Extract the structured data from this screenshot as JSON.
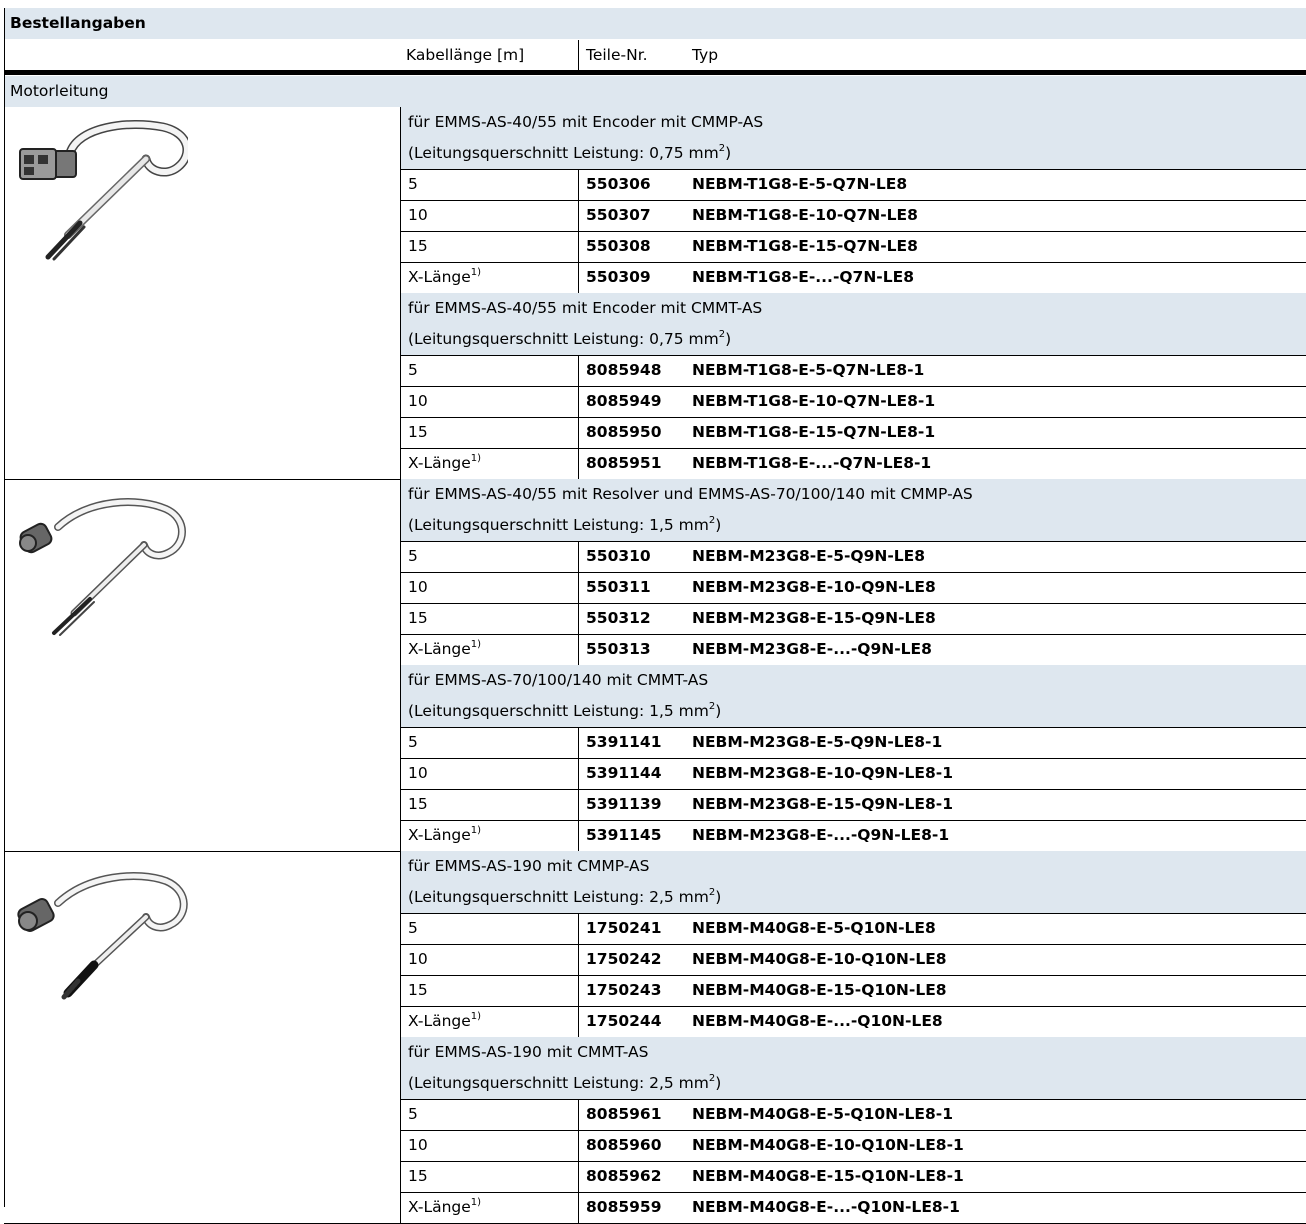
{
  "title": "Bestellangaben",
  "columns": {
    "length": "Kabellänge [m]",
    "part_no": "Teile-Nr.",
    "type": "Typ"
  },
  "section_label": "Motorleitung",
  "groups": [
    {
      "cable": "t1g8",
      "subgroups": [
        {
          "line1": "für EMMS-AS-40/55 mit Encoder mit CMMP-AS",
          "line2_pre": "(Leitungsquerschnitt Leistung: 0,75 mm",
          "line2_sup": "2",
          "line2_post": ")",
          "rows": [
            {
              "length": "5",
              "sup": "",
              "part": "550306",
              "type": "NEBM-T1G8-E-5-Q7N-LE8"
            },
            {
              "length": "10",
              "sup": "",
              "part": "550307",
              "type": "NEBM-T1G8-E-10-Q7N-LE8"
            },
            {
              "length": "15",
              "sup": "",
              "part": "550308",
              "type": "NEBM-T1G8-E-15-Q7N-LE8"
            },
            {
              "length": "X-Länge",
              "sup": "1)",
              "part": "550309",
              "type": "NEBM-T1G8-E-...-Q7N-LE8"
            }
          ]
        },
        {
          "line1": "für EMMS-AS-40/55 mit Encoder mit CMMT-AS",
          "line2_pre": "(Leitungsquerschnitt Leistung: 0,75 mm",
          "line2_sup": "2",
          "line2_post": ")",
          "rows": [
            {
              "length": "5",
              "sup": "",
              "part": "8085948",
              "type": "NEBM-T1G8-E-5-Q7N-LE8-1"
            },
            {
              "length": "10",
              "sup": "",
              "part": "8085949",
              "type": "NEBM-T1G8-E-10-Q7N-LE8-1"
            },
            {
              "length": "15",
              "sup": "",
              "part": "8085950",
              "type": "NEBM-T1G8-E-15-Q7N-LE8-1"
            },
            {
              "length": "X-Länge",
              "sup": "1)",
              "part": "8085951",
              "type": "NEBM-T1G8-E-...-Q7N-LE8-1"
            }
          ]
        }
      ]
    },
    {
      "cable": "m23",
      "subgroups": [
        {
          "line1": "für EMMS-AS-40/55 mit Resolver und EMMS-AS-70/100/140 mit CMMP-AS",
          "line2_pre": "(Leitungsquerschnitt Leistung: 1,5 mm",
          "line2_sup": "2",
          "line2_post": ")",
          "rows": [
            {
              "length": "5",
              "sup": "",
              "part": "550310",
              "type": "NEBM-M23G8-E-5-Q9N-LE8"
            },
            {
              "length": "10",
              "sup": "",
              "part": "550311",
              "type": "NEBM-M23G8-E-10-Q9N-LE8"
            },
            {
              "length": "15",
              "sup": "",
              "part": "550312",
              "type": "NEBM-M23G8-E-15-Q9N-LE8"
            },
            {
              "length": "X-Länge",
              "sup": "1)",
              "part": "550313",
              "type": "NEBM-M23G8-E-...-Q9N-LE8"
            }
          ]
        },
        {
          "line1": "für EMMS-AS-70/100/140 mit CMMT-AS",
          "line2_pre": "(Leitungsquerschnitt Leistung: 1,5 mm",
          "line2_sup": "2",
          "line2_post": ")",
          "rows": [
            {
              "length": "5",
              "sup": "",
              "part": "5391141",
              "type": "NEBM-M23G8-E-5-Q9N-LE8-1"
            },
            {
              "length": "10",
              "sup": "",
              "part": "5391144",
              "type": "NEBM-M23G8-E-10-Q9N-LE8-1"
            },
            {
              "length": "15",
              "sup": "",
              "part": "5391139",
              "type": "NEBM-M23G8-E-15-Q9N-LE8-1"
            },
            {
              "length": "X-Länge",
              "sup": "1)",
              "part": "5391145",
              "type": "NEBM-M23G8-E-...-Q9N-LE8-1"
            }
          ]
        }
      ]
    },
    {
      "cable": "m40",
      "subgroups": [
        {
          "line1": "für EMMS-AS-190 mit CMMP-AS",
          "line2_pre": "(Leitungsquerschnitt Leistung: 2,5 mm",
          "line2_sup": "2",
          "line2_post": ")",
          "rows": [
            {
              "length": "5",
              "sup": "",
              "part": "1750241",
              "type": "NEBM-M40G8-E-5-Q10N-LE8"
            },
            {
              "length": "10",
              "sup": "",
              "part": "1750242",
              "type": "NEBM-M40G8-E-10-Q10N-LE8"
            },
            {
              "length": "15",
              "sup": "",
              "part": "1750243",
              "type": "NEBM-M40G8-E-15-Q10N-LE8"
            },
            {
              "length": "X-Länge",
              "sup": "1)",
              "part": "1750244",
              "type": "NEBM-M40G8-E-...-Q10N-LE8"
            }
          ]
        },
        {
          "line1": "für EMMS-AS-190 mit CMMT-AS",
          "line2_pre": "(Leitungsquerschnitt Leistung: 2,5 mm",
          "line2_sup": "2",
          "line2_post": ")",
          "rows": [
            {
              "length": "5",
              "sup": "",
              "part": "8085961",
              "type": "NEBM-M40G8-E-5-Q10N-LE8-1"
            },
            {
              "length": "10",
              "sup": "",
              "part": "8085960",
              "type": "NEBM-M40G8-E-10-Q10N-LE8-1"
            },
            {
              "length": "15",
              "sup": "",
              "part": "8085962",
              "type": "NEBM-M40G8-E-15-Q10N-LE8-1"
            },
            {
              "length": "X-Länge",
              "sup": "1)",
              "part": "8085959",
              "type": "NEBM-M40G8-E-...-Q10N-LE8-1"
            }
          ]
        }
      ]
    }
  ]
}
